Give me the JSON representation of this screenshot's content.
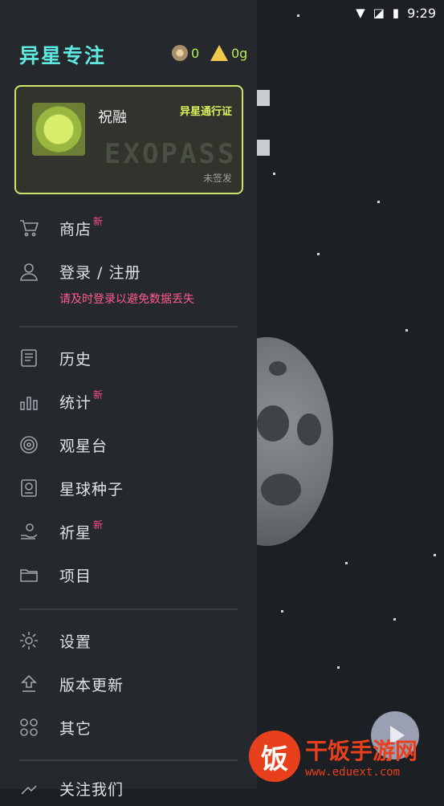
{
  "status_bar": {
    "time": "9:29"
  },
  "app": {
    "title": "异星专注"
  },
  "currency": {
    "coins": "0",
    "gems": "0g"
  },
  "card": {
    "name": "祝融",
    "badge": "异星通行证",
    "watermark": "EXOPASS",
    "status": "未签发"
  },
  "menu": {
    "shop": {
      "label": "商店",
      "badge": "新"
    },
    "login": {
      "label": "登录 / 注册",
      "hint": "请及时登录以避免数据丢失"
    },
    "history": {
      "label": "历史"
    },
    "stats": {
      "label": "统计",
      "badge": "新"
    },
    "observatory": {
      "label": "观星台"
    },
    "seeds": {
      "label": "星球种子"
    },
    "pray": {
      "label": "祈星",
      "badge": "新"
    },
    "projects": {
      "label": "项目"
    },
    "settings": {
      "label": "设置"
    },
    "update": {
      "label": "版本更新"
    },
    "other": {
      "label": "其它"
    },
    "follow": {
      "label": "关注我们"
    }
  },
  "watermark": {
    "brand": "干饭手游网",
    "url": "www.eduext.com",
    "logo_char": "饭"
  },
  "colors": {
    "accent_cyan": "#5ee8e0",
    "accent_lime": "#cde66a",
    "new_badge": "#ff4a8a"
  }
}
